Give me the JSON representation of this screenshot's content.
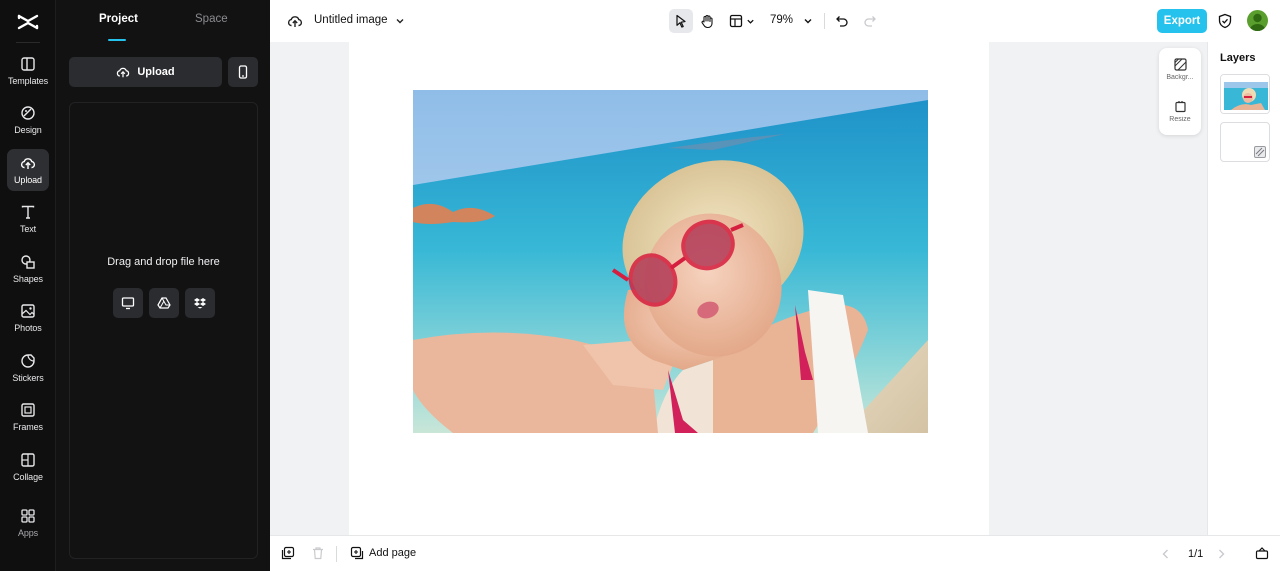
{
  "rail": {
    "items": [
      {
        "label": "Templates",
        "icon": "templates-icon"
      },
      {
        "label": "Design",
        "icon": "design-icon"
      },
      {
        "label": "Upload",
        "icon": "upload-icon",
        "active": true
      },
      {
        "label": "Text",
        "icon": "text-icon"
      },
      {
        "label": "Shapes",
        "icon": "shapes-icon"
      },
      {
        "label": "Photos",
        "icon": "photos-icon"
      },
      {
        "label": "Stickers",
        "icon": "stickers-icon"
      },
      {
        "label": "Frames",
        "icon": "frames-icon"
      },
      {
        "label": "Collage",
        "icon": "collage-icon"
      },
      {
        "label": "Apps",
        "icon": "apps-icon"
      }
    ]
  },
  "panel": {
    "tabs": [
      {
        "label": "Project"
      },
      {
        "label": "Space"
      }
    ],
    "upload_label": "Upload",
    "drop_text": "Drag and drop file here",
    "sources": [
      "computer-icon",
      "google-drive-icon",
      "dropbox-icon"
    ]
  },
  "topbar": {
    "title": "Untitled image",
    "zoom": "79%",
    "export_label": "Export"
  },
  "float_tools": {
    "background_label": "Backgr...",
    "resize_label": "Resize"
  },
  "layers": {
    "title": "Layers"
  },
  "bottombar": {
    "add_page_label": "Add page",
    "page_indicator": "1/1"
  },
  "colors": {
    "accent": "#25c2ed",
    "rail_bg": "#0f0f10",
    "panel_bg": "#121213",
    "canvas_bg": "#f1f2f4",
    "avatar": "#5a9f2e"
  }
}
